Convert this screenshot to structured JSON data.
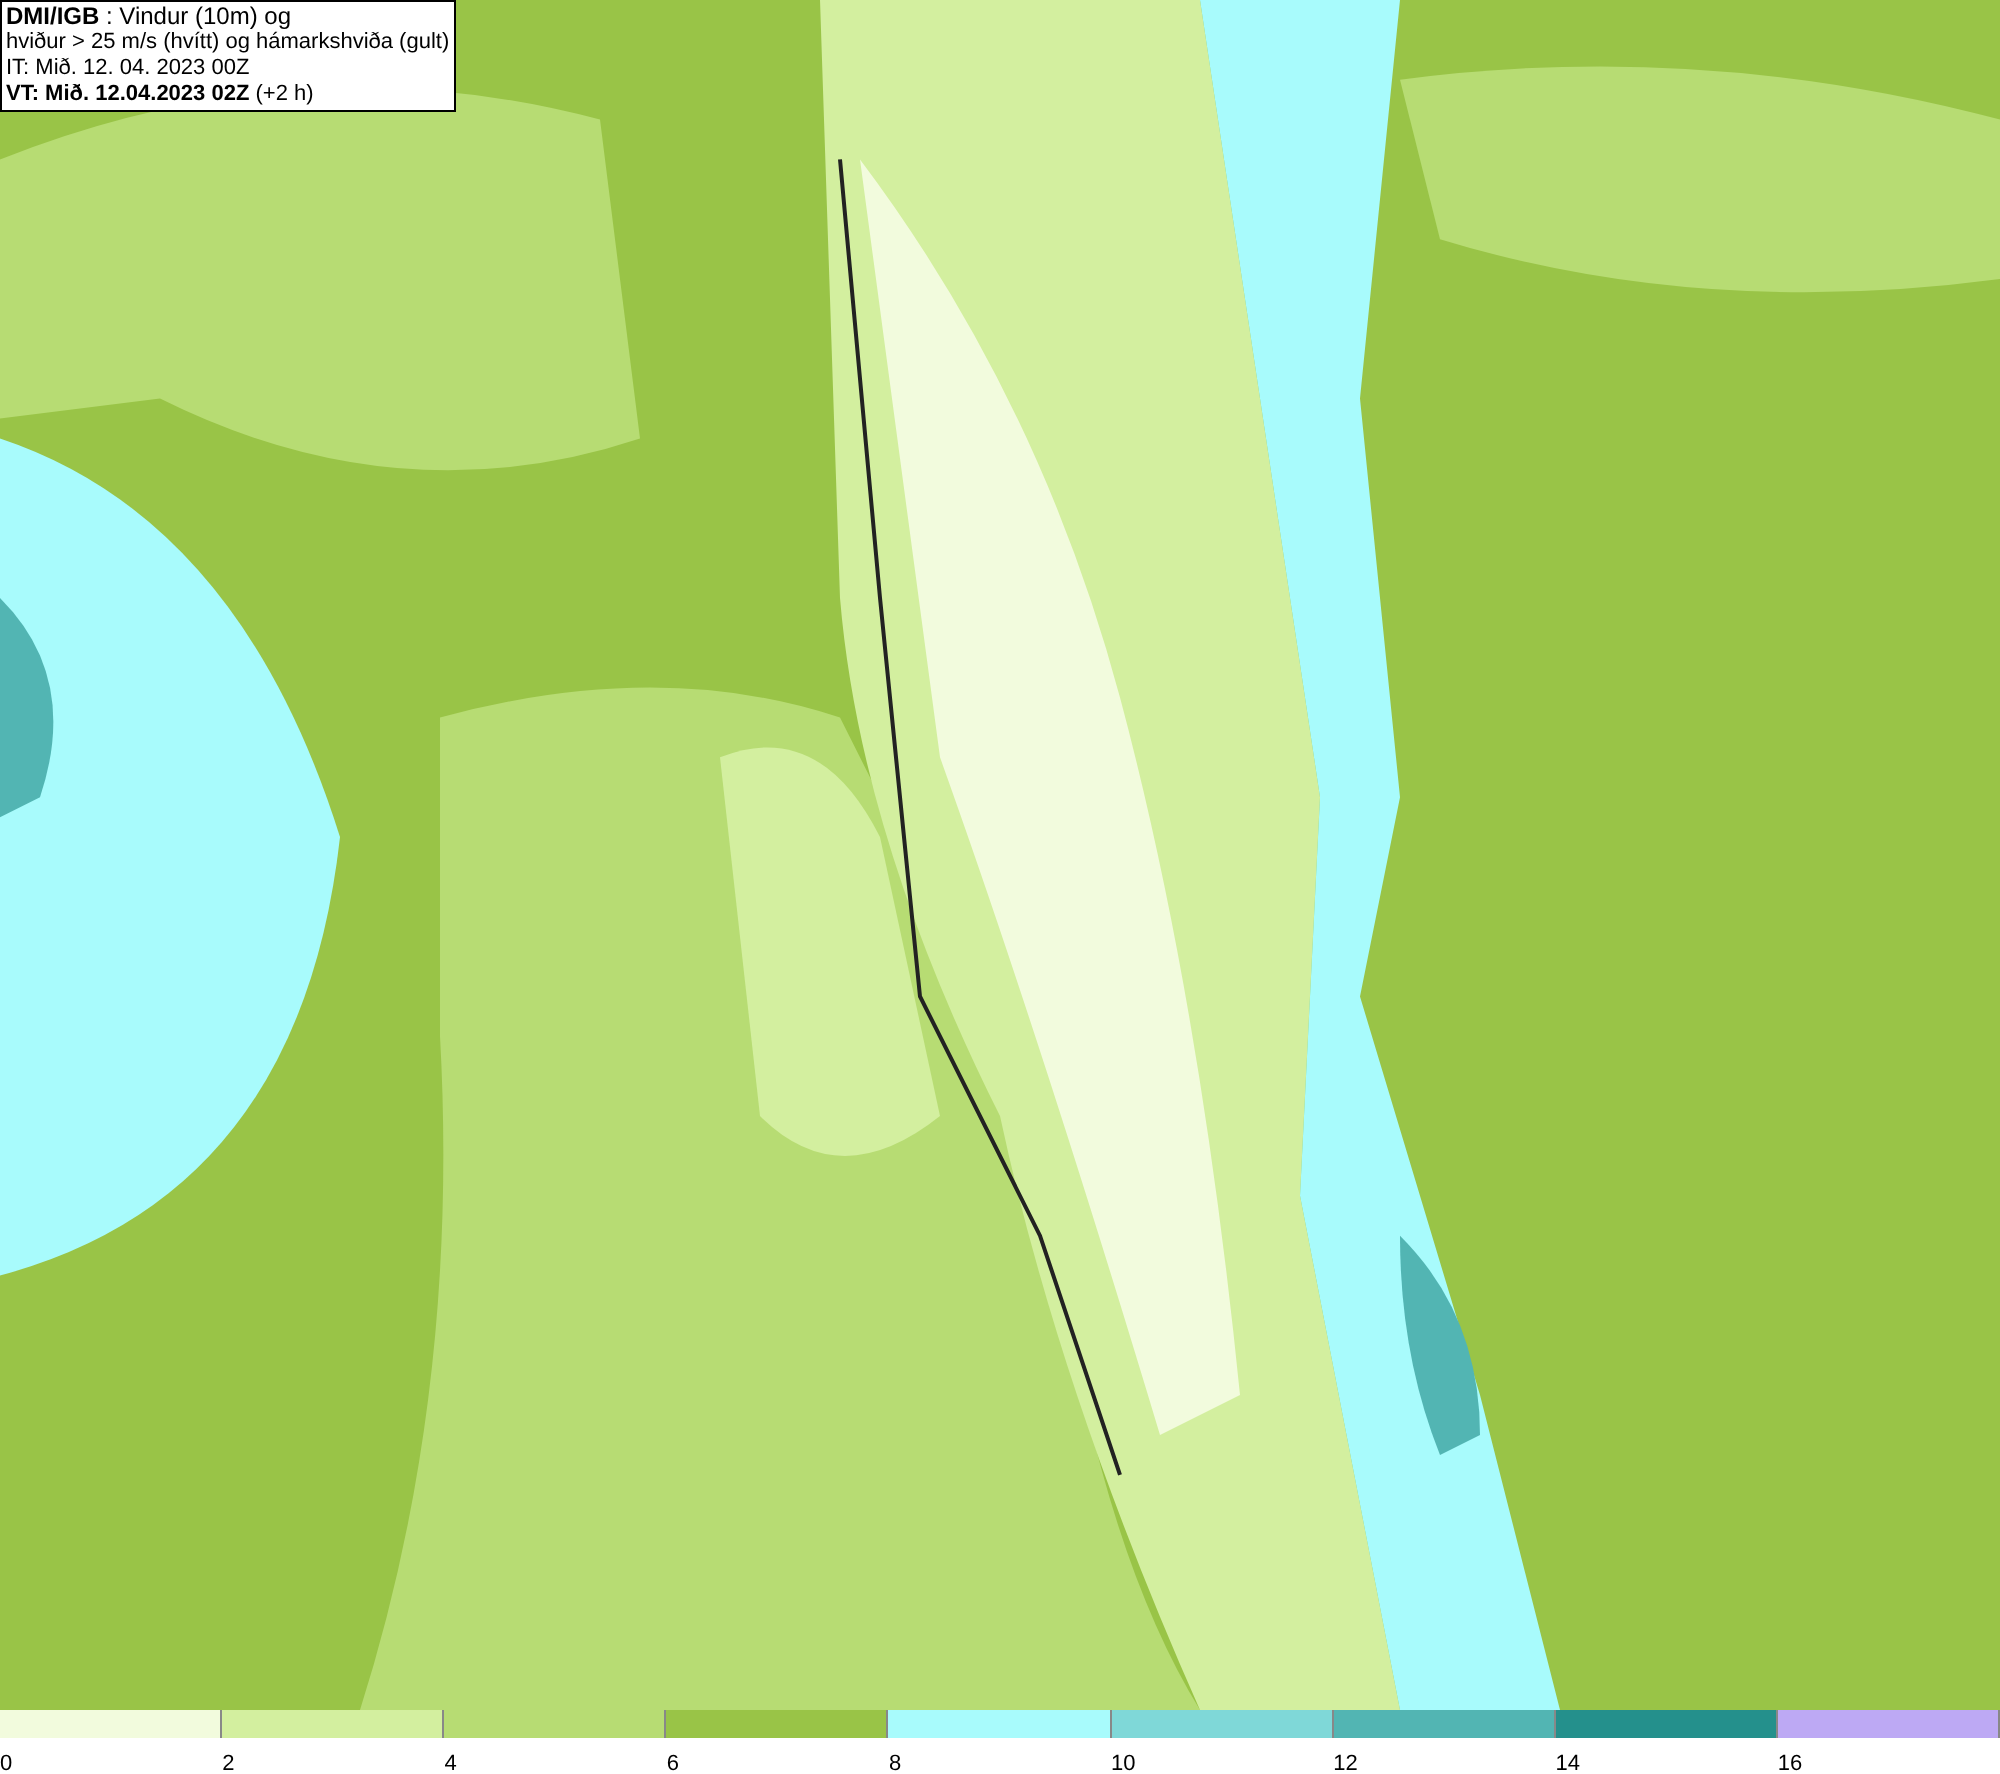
{
  "title_box": {
    "lines": [
      "**DMI/IGB** : Vindur (10m) og",
      "hviður > 25 m/s (hvítt) og hámarkshviða (gult)",
      "IT: Mið. 12. 04. 2023 00Z",
      "**VT: Mið. 12.04.2023 02Z** (+2 h)"
    ]
  },
  "legend": {
    "bins": [
      {
        "color": "#f2fbdd",
        "label": "0"
      },
      {
        "color": "#d3ef9f",
        "label": "2"
      },
      {
        "color": "#b7dc73",
        "label": "4"
      },
      {
        "color": "#99c447",
        "label": "6"
      },
      {
        "color": "#a8fbfc",
        "label": "8"
      },
      {
        "color": "#7fd8d8",
        "label": "10"
      },
      {
        "color": "#52b5b3",
        "label": "12"
      },
      {
        "color": "#24908c",
        "label": "14"
      },
      {
        "color": "#bda9f4",
        "label": "16"
      }
    ]
  }
}
